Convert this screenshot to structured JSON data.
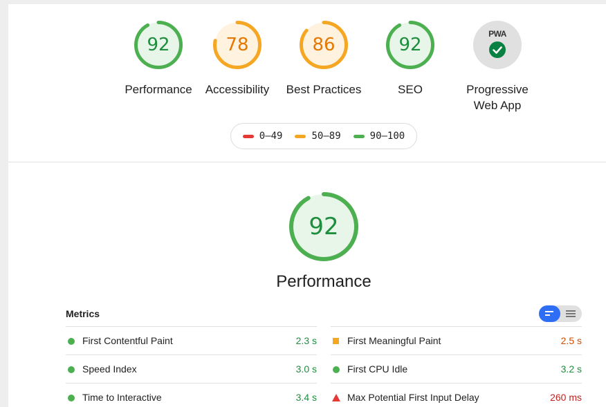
{
  "colors": {
    "pass": "#4caf50",
    "average": "#f5a623",
    "fail": "#e53935",
    "pass_fill": "#e8f5e9",
    "average_fill": "#fff3e0",
    "accent": "#2e6ef5"
  },
  "gauges": [
    {
      "label": "Performance",
      "score": 92,
      "rating": "pass"
    },
    {
      "label": "Accessibility",
      "score": 78,
      "rating": "average"
    },
    {
      "label": "Best Practices",
      "score": 86,
      "rating": "average"
    },
    {
      "label": "SEO",
      "score": 92,
      "rating": "pass"
    }
  ],
  "pwa": {
    "badge_text": "PWA",
    "label": "Progressive\nWeb App",
    "icon": "check-circle-icon"
  },
  "legend": [
    {
      "range": "0–49",
      "rating": "fail"
    },
    {
      "range": "50–89",
      "rating": "average"
    },
    {
      "range": "90–100",
      "rating": "pass"
    }
  ],
  "main": {
    "score": 92,
    "label": "Performance",
    "rating": "pass"
  },
  "metrics": {
    "title": "Metrics",
    "toggle_icons": [
      "list-view-icon",
      "text-view-icon"
    ],
    "left": [
      {
        "name": "First Contentful Paint",
        "value": "2.3 s",
        "rating": "pass"
      },
      {
        "name": "Speed Index",
        "value": "3.0 s",
        "rating": "pass"
      },
      {
        "name": "Time to Interactive",
        "value": "3.4 s",
        "rating": "pass"
      }
    ],
    "right": [
      {
        "name": "First Meaningful Paint",
        "value": "2.5 s",
        "rating": "average"
      },
      {
        "name": "First CPU Idle",
        "value": "3.2 s",
        "rating": "pass"
      },
      {
        "name": "Max Potential First Input Delay",
        "value": "260 ms",
        "rating": "fail"
      }
    ]
  }
}
